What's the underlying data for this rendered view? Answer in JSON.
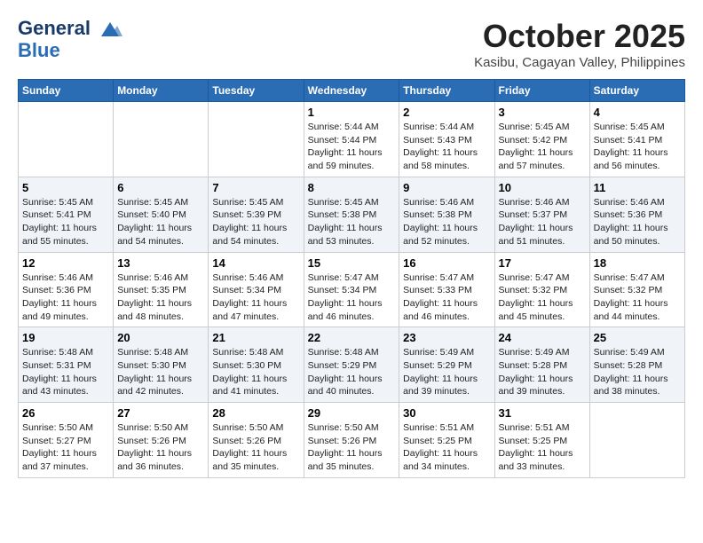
{
  "header": {
    "logo_line1": "General",
    "logo_line2": "Blue",
    "month_title": "October 2025",
    "location": "Kasibu, Cagayan Valley, Philippines"
  },
  "days_of_week": [
    "Sunday",
    "Monday",
    "Tuesday",
    "Wednesday",
    "Thursday",
    "Friday",
    "Saturday"
  ],
  "weeks": [
    [
      {
        "day": "",
        "sunrise": "",
        "sunset": "",
        "daylight": ""
      },
      {
        "day": "",
        "sunrise": "",
        "sunset": "",
        "daylight": ""
      },
      {
        "day": "",
        "sunrise": "",
        "sunset": "",
        "daylight": ""
      },
      {
        "day": "1",
        "sunrise": "Sunrise: 5:44 AM",
        "sunset": "Sunset: 5:44 PM",
        "daylight": "Daylight: 11 hours and 59 minutes."
      },
      {
        "day": "2",
        "sunrise": "Sunrise: 5:44 AM",
        "sunset": "Sunset: 5:43 PM",
        "daylight": "Daylight: 11 hours and 58 minutes."
      },
      {
        "day": "3",
        "sunrise": "Sunrise: 5:45 AM",
        "sunset": "Sunset: 5:42 PM",
        "daylight": "Daylight: 11 hours and 57 minutes."
      },
      {
        "day": "4",
        "sunrise": "Sunrise: 5:45 AM",
        "sunset": "Sunset: 5:41 PM",
        "daylight": "Daylight: 11 hours and 56 minutes."
      }
    ],
    [
      {
        "day": "5",
        "sunrise": "Sunrise: 5:45 AM",
        "sunset": "Sunset: 5:41 PM",
        "daylight": "Daylight: 11 hours and 55 minutes."
      },
      {
        "day": "6",
        "sunrise": "Sunrise: 5:45 AM",
        "sunset": "Sunset: 5:40 PM",
        "daylight": "Daylight: 11 hours and 54 minutes."
      },
      {
        "day": "7",
        "sunrise": "Sunrise: 5:45 AM",
        "sunset": "Sunset: 5:39 PM",
        "daylight": "Daylight: 11 hours and 54 minutes."
      },
      {
        "day": "8",
        "sunrise": "Sunrise: 5:45 AM",
        "sunset": "Sunset: 5:38 PM",
        "daylight": "Daylight: 11 hours and 53 minutes."
      },
      {
        "day": "9",
        "sunrise": "Sunrise: 5:46 AM",
        "sunset": "Sunset: 5:38 PM",
        "daylight": "Daylight: 11 hours and 52 minutes."
      },
      {
        "day": "10",
        "sunrise": "Sunrise: 5:46 AM",
        "sunset": "Sunset: 5:37 PM",
        "daylight": "Daylight: 11 hours and 51 minutes."
      },
      {
        "day": "11",
        "sunrise": "Sunrise: 5:46 AM",
        "sunset": "Sunset: 5:36 PM",
        "daylight": "Daylight: 11 hours and 50 minutes."
      }
    ],
    [
      {
        "day": "12",
        "sunrise": "Sunrise: 5:46 AM",
        "sunset": "Sunset: 5:36 PM",
        "daylight": "Daylight: 11 hours and 49 minutes."
      },
      {
        "day": "13",
        "sunrise": "Sunrise: 5:46 AM",
        "sunset": "Sunset: 5:35 PM",
        "daylight": "Daylight: 11 hours and 48 minutes."
      },
      {
        "day": "14",
        "sunrise": "Sunrise: 5:46 AM",
        "sunset": "Sunset: 5:34 PM",
        "daylight": "Daylight: 11 hours and 47 minutes."
      },
      {
        "day": "15",
        "sunrise": "Sunrise: 5:47 AM",
        "sunset": "Sunset: 5:34 PM",
        "daylight": "Daylight: 11 hours and 46 minutes."
      },
      {
        "day": "16",
        "sunrise": "Sunrise: 5:47 AM",
        "sunset": "Sunset: 5:33 PM",
        "daylight": "Daylight: 11 hours and 46 minutes."
      },
      {
        "day": "17",
        "sunrise": "Sunrise: 5:47 AM",
        "sunset": "Sunset: 5:32 PM",
        "daylight": "Daylight: 11 hours and 45 minutes."
      },
      {
        "day": "18",
        "sunrise": "Sunrise: 5:47 AM",
        "sunset": "Sunset: 5:32 PM",
        "daylight": "Daylight: 11 hours and 44 minutes."
      }
    ],
    [
      {
        "day": "19",
        "sunrise": "Sunrise: 5:48 AM",
        "sunset": "Sunset: 5:31 PM",
        "daylight": "Daylight: 11 hours and 43 minutes."
      },
      {
        "day": "20",
        "sunrise": "Sunrise: 5:48 AM",
        "sunset": "Sunset: 5:30 PM",
        "daylight": "Daylight: 11 hours and 42 minutes."
      },
      {
        "day": "21",
        "sunrise": "Sunrise: 5:48 AM",
        "sunset": "Sunset: 5:30 PM",
        "daylight": "Daylight: 11 hours and 41 minutes."
      },
      {
        "day": "22",
        "sunrise": "Sunrise: 5:48 AM",
        "sunset": "Sunset: 5:29 PM",
        "daylight": "Daylight: 11 hours and 40 minutes."
      },
      {
        "day": "23",
        "sunrise": "Sunrise: 5:49 AM",
        "sunset": "Sunset: 5:29 PM",
        "daylight": "Daylight: 11 hours and 39 minutes."
      },
      {
        "day": "24",
        "sunrise": "Sunrise: 5:49 AM",
        "sunset": "Sunset: 5:28 PM",
        "daylight": "Daylight: 11 hours and 39 minutes."
      },
      {
        "day": "25",
        "sunrise": "Sunrise: 5:49 AM",
        "sunset": "Sunset: 5:28 PM",
        "daylight": "Daylight: 11 hours and 38 minutes."
      }
    ],
    [
      {
        "day": "26",
        "sunrise": "Sunrise: 5:50 AM",
        "sunset": "Sunset: 5:27 PM",
        "daylight": "Daylight: 11 hours and 37 minutes."
      },
      {
        "day": "27",
        "sunrise": "Sunrise: 5:50 AM",
        "sunset": "Sunset: 5:26 PM",
        "daylight": "Daylight: 11 hours and 36 minutes."
      },
      {
        "day": "28",
        "sunrise": "Sunrise: 5:50 AM",
        "sunset": "Sunset: 5:26 PM",
        "daylight": "Daylight: 11 hours and 35 minutes."
      },
      {
        "day": "29",
        "sunrise": "Sunrise: 5:50 AM",
        "sunset": "Sunset: 5:26 PM",
        "daylight": "Daylight: 11 hours and 35 minutes."
      },
      {
        "day": "30",
        "sunrise": "Sunrise: 5:51 AM",
        "sunset": "Sunset: 5:25 PM",
        "daylight": "Daylight: 11 hours and 34 minutes."
      },
      {
        "day": "31",
        "sunrise": "Sunrise: 5:51 AM",
        "sunset": "Sunset: 5:25 PM",
        "daylight": "Daylight: 11 hours and 33 minutes."
      },
      {
        "day": "",
        "sunrise": "",
        "sunset": "",
        "daylight": ""
      }
    ]
  ]
}
